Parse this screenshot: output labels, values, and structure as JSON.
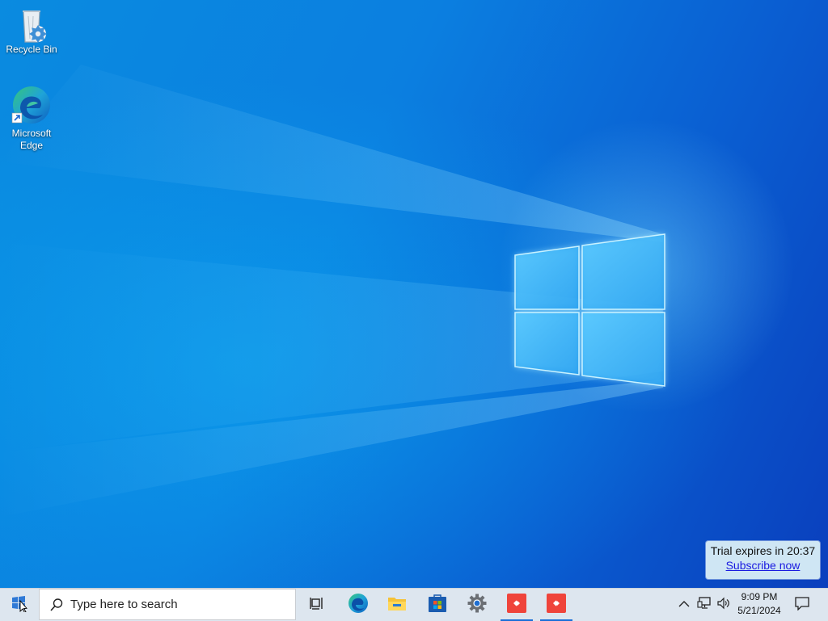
{
  "desktop": {
    "icons": [
      {
        "label": "Recycle Bin",
        "icon": "recycle-bin-icon"
      },
      {
        "label": "Microsoft Edge",
        "icon": "edge-icon"
      }
    ]
  },
  "trial_notice": {
    "text": "Trial expires in 20:37",
    "link": "Subscribe now"
  },
  "taskbar": {
    "start_icon": "windows-start-icon",
    "search_placeholder": "Type here to search",
    "apps": [
      {
        "name": "Task View",
        "icon": "task-view-icon"
      },
      {
        "name": "Microsoft Edge",
        "icon": "edge-icon"
      },
      {
        "name": "File Explorer",
        "icon": "folder-icon"
      },
      {
        "name": "Microsoft Store",
        "icon": "store-icon"
      },
      {
        "name": "Settings",
        "icon": "settings-gear-icon"
      },
      {
        "name": "AnyDesk",
        "icon": "anydesk-icon",
        "active": true
      },
      {
        "name": "AnyDesk",
        "icon": "anydesk-icon",
        "active": true
      }
    ],
    "tray": {
      "icons": [
        "chevron-up-icon",
        "network-icon",
        "volume-icon"
      ],
      "time": "9:09 PM",
      "date": "5/21/2024",
      "notification_icon": "notification-icon"
    }
  },
  "colors": {
    "accent": "#1a6fd8",
    "anydesk": "#ef443b",
    "taskbar": "#dde6ef"
  }
}
